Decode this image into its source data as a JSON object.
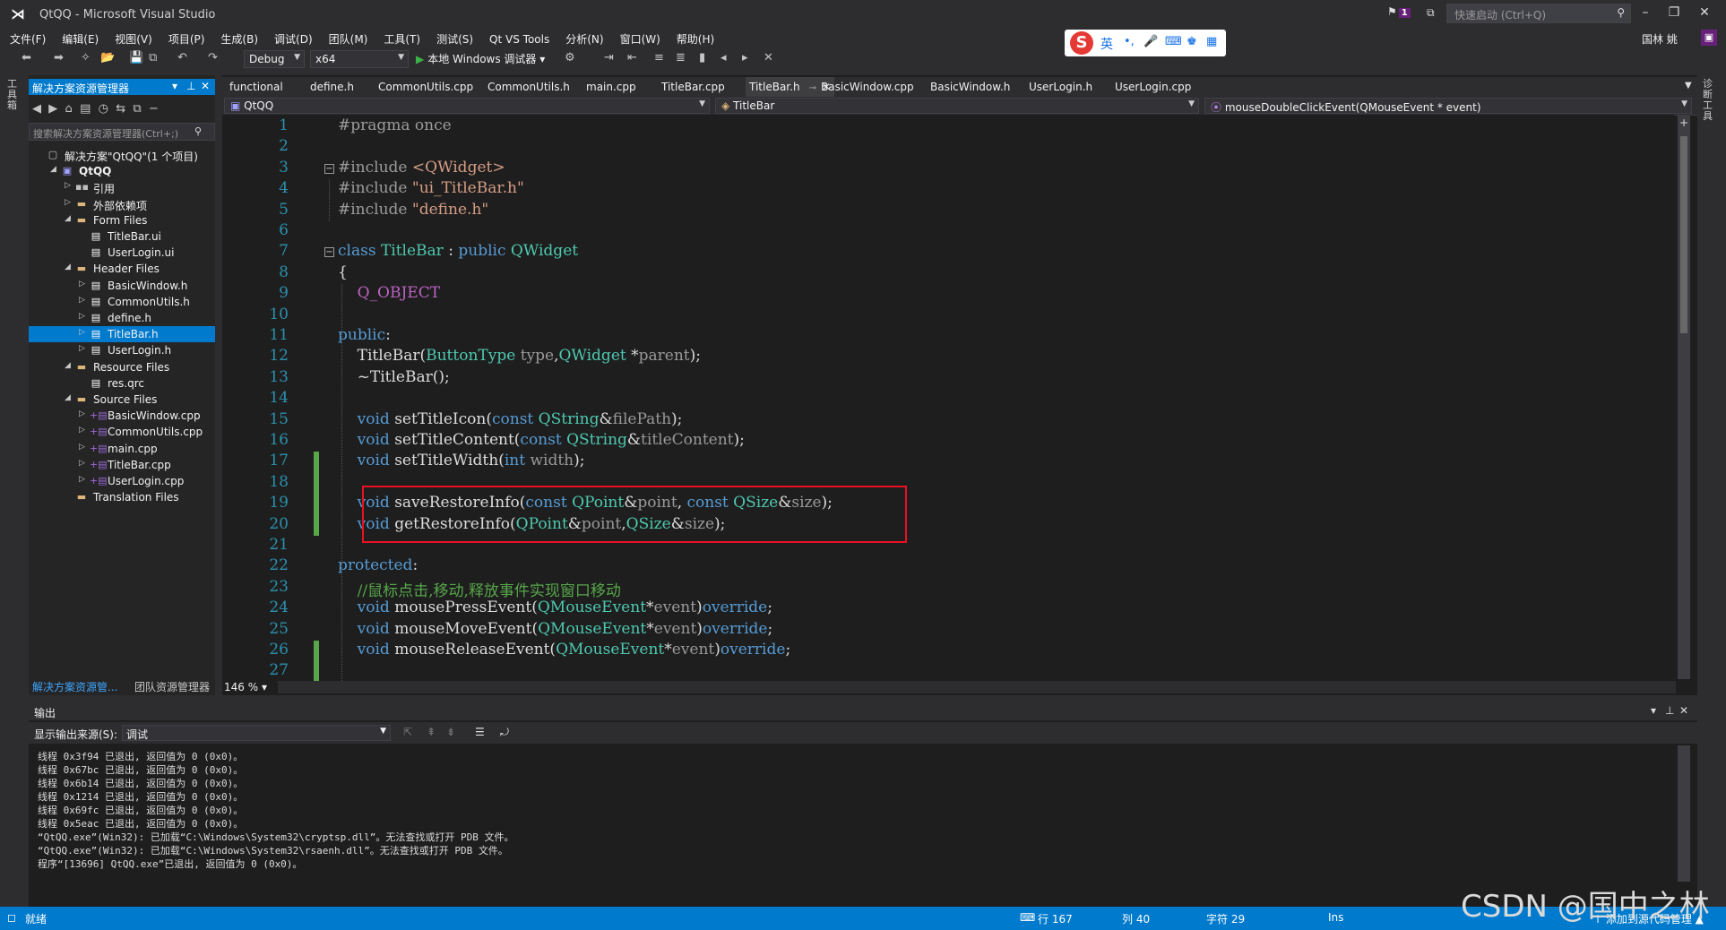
{
  "window": {
    "title": "QtQQ - Microsoft Visual Studio",
    "quick_launch_placeholder": "快速启动 (Ctrl+Q)",
    "notification_count": "1",
    "user_name": "国林 姚"
  },
  "menu": [
    "文件(F)",
    "编辑(E)",
    "视图(V)",
    "项目(P)",
    "生成(B)",
    "调试(D)",
    "团队(M)",
    "工具(T)",
    "测试(S)",
    "Qt VS Tools",
    "分析(N)",
    "窗口(W)",
    "帮助(H)"
  ],
  "ime": {
    "label": "英"
  },
  "toolbar": {
    "config": "Debug",
    "platform": "x64",
    "run_label": "本地 Windows 调试器"
  },
  "left_strip": {
    "label": "工具箱"
  },
  "right_strip": {
    "label": "诊断工具"
  },
  "solution_explorer": {
    "title": "解决方案资源管理器",
    "search_placeholder": "搜索解决方案资源管理器(Ctrl+;)",
    "items": [
      {
        "label": "解决方案\"QtQQ\"(1 个项目)",
        "type": "sol",
        "level": 0,
        "twisty": ""
      },
      {
        "label": "QtQQ",
        "type": "proj",
        "level": 1,
        "twisty": "◢"
      },
      {
        "label": "引用",
        "type": "ref",
        "level": 2,
        "twisty": "▷"
      },
      {
        "label": "外部依赖项",
        "type": "folder",
        "level": 2,
        "twisty": "▷"
      },
      {
        "label": "Form Files",
        "type": "folder",
        "level": 2,
        "twisty": "◢"
      },
      {
        "label": "TitleBar.ui",
        "type": "file",
        "level": 3,
        "twisty": ""
      },
      {
        "label": "UserLogin.ui",
        "type": "file",
        "level": 3,
        "twisty": ""
      },
      {
        "label": "Header Files",
        "type": "folder",
        "level": 2,
        "twisty": "◢"
      },
      {
        "label": "BasicWindow.h",
        "type": "file",
        "level": 3,
        "twisty": "▷"
      },
      {
        "label": "CommonUtils.h",
        "type": "file",
        "level": 3,
        "twisty": "▷"
      },
      {
        "label": "define.h",
        "type": "file",
        "level": 3,
        "twisty": "▷"
      },
      {
        "label": "TitleBar.h",
        "type": "file",
        "level": 3,
        "twisty": "▷",
        "selected": true
      },
      {
        "label": "UserLogin.h",
        "type": "file",
        "level": 3,
        "twisty": "▷"
      },
      {
        "label": "Resource Files",
        "type": "folder",
        "level": 2,
        "twisty": "◢"
      },
      {
        "label": "res.qrc",
        "type": "file",
        "level": 3,
        "twisty": ""
      },
      {
        "label": "Source Files",
        "type": "folder",
        "level": 2,
        "twisty": "◢"
      },
      {
        "label": "BasicWindow.cpp",
        "type": "cpp",
        "level": 3,
        "twisty": "▷"
      },
      {
        "label": "CommonUtils.cpp",
        "type": "cpp",
        "level": 3,
        "twisty": "▷"
      },
      {
        "label": "main.cpp",
        "type": "cpp",
        "level": 3,
        "twisty": "▷"
      },
      {
        "label": "TitleBar.cpp",
        "type": "cpp",
        "level": 3,
        "twisty": "▷"
      },
      {
        "label": "UserLogin.cpp",
        "type": "cpp",
        "level": 3,
        "twisty": "▷"
      },
      {
        "label": "Translation Files",
        "type": "folder",
        "level": 2,
        "twisty": ""
      }
    ],
    "bottom_tabs": [
      "解决方案资源管...",
      "团队资源管理器"
    ]
  },
  "editor": {
    "tabs": [
      {
        "label": "functional"
      },
      {
        "label": "define.h"
      },
      {
        "label": "CommonUtils.cpp"
      },
      {
        "label": "CommonUtils.h"
      },
      {
        "label": "main.cpp"
      },
      {
        "label": "TitleBar.cpp"
      },
      {
        "label": "TitleBar.h",
        "active": true
      },
      {
        "label": "BasicWindow.cpp"
      },
      {
        "label": "BasicWindow.h"
      },
      {
        "label": "UserLogin.h"
      },
      {
        "label": "UserLogin.cpp"
      }
    ],
    "nav_project": "QtQQ",
    "nav_class": "TitleBar",
    "nav_member": "mouseDoubleClickEvent(QMouseEvent * event)",
    "zoom": "146 %",
    "lines": [
      [
        [
          "pp",
          "#pragma once"
        ]
      ],
      [],
      [
        [
          "pp",
          "#include "
        ],
        [
          "st",
          "<QWidget>"
        ]
      ],
      [
        [
          "pp",
          "#include "
        ],
        [
          "st",
          "\"ui_TitleBar.h\""
        ]
      ],
      [
        [
          "pp",
          "#include "
        ],
        [
          "st",
          "\"define.h\""
        ]
      ],
      [],
      [
        [
          "kw",
          "class "
        ],
        [
          "ty",
          "TitleBar"
        ],
        [
          "tx",
          " : "
        ],
        [
          "kw",
          "public "
        ],
        [
          "ty",
          "QWidget"
        ]
      ],
      [
        [
          "tx",
          "{"
        ]
      ],
      [
        [
          "tx",
          "    "
        ],
        [
          "mc",
          "Q_OBJECT"
        ]
      ],
      [],
      [
        [
          "kw",
          "public"
        ],
        [
          "tx",
          ":"
        ]
      ],
      [
        [
          "tx",
          "    TitleBar("
        ],
        [
          "ty",
          "ButtonType"
        ],
        [
          "pm",
          " type"
        ],
        [
          "tx",
          ","
        ],
        [
          "ty",
          "QWidget"
        ],
        [
          "tx",
          " *"
        ],
        [
          "pm",
          "parent"
        ],
        [
          "tx",
          ");"
        ]
      ],
      [
        [
          "tx",
          "    ~TitleBar();"
        ]
      ],
      [],
      [
        [
          "tx",
          "    "
        ],
        [
          "kw",
          "void"
        ],
        [
          "tx",
          " setTitleIcon("
        ],
        [
          "kw",
          "const"
        ],
        [
          "tx",
          " "
        ],
        [
          "ty",
          "QString"
        ],
        [
          "tx",
          "&"
        ],
        [
          "pm",
          "filePath"
        ],
        [
          "tx",
          ");"
        ]
      ],
      [
        [
          "tx",
          "    "
        ],
        [
          "kw",
          "void"
        ],
        [
          "tx",
          " setTitleContent("
        ],
        [
          "kw",
          "const"
        ],
        [
          "tx",
          " "
        ],
        [
          "ty",
          "QString"
        ],
        [
          "tx",
          "&"
        ],
        [
          "pm",
          "titleContent"
        ],
        [
          "tx",
          ");"
        ]
      ],
      [
        [
          "tx",
          "    "
        ],
        [
          "kw",
          "void"
        ],
        [
          "tx",
          " setTitleWidth("
        ],
        [
          "kw",
          "int"
        ],
        [
          "pm",
          " width"
        ],
        [
          "tx",
          ");"
        ]
      ],
      [],
      [
        [
          "tx",
          "    "
        ],
        [
          "kw",
          "void"
        ],
        [
          "tx",
          " saveRestoreInfo("
        ],
        [
          "kw",
          "const"
        ],
        [
          "tx",
          " "
        ],
        [
          "ty",
          "QPoint"
        ],
        [
          "tx",
          "&"
        ],
        [
          "pm",
          "point"
        ],
        [
          "tx",
          ", "
        ],
        [
          "kw",
          "const"
        ],
        [
          "tx",
          " "
        ],
        [
          "ty",
          "QSize"
        ],
        [
          "tx",
          "&"
        ],
        [
          "pm",
          "size"
        ],
        [
          "tx",
          ");"
        ]
      ],
      [
        [
          "tx",
          "    "
        ],
        [
          "kw",
          "void"
        ],
        [
          "tx",
          " getRestoreInfo("
        ],
        [
          "ty",
          "QPoint"
        ],
        [
          "tx",
          "&"
        ],
        [
          "pm",
          "point"
        ],
        [
          "tx",
          ","
        ],
        [
          "ty",
          "QSize"
        ],
        [
          "tx",
          "&"
        ],
        [
          "pm",
          "size"
        ],
        [
          "tx",
          ");"
        ]
      ],
      [],
      [
        [
          "kw",
          "protected"
        ],
        [
          "tx",
          ":"
        ]
      ],
      [
        [
          "tx",
          "    "
        ],
        [
          "cm",
          "//鼠标点击,移动,释放事件实现窗口移动"
        ]
      ],
      [
        [
          "tx",
          "    "
        ],
        [
          "kw",
          "void"
        ],
        [
          "tx",
          " mousePressEvent("
        ],
        [
          "ty",
          "QMouseEvent"
        ],
        [
          "tx",
          "*"
        ],
        [
          "pm",
          "event"
        ],
        [
          "tx",
          ")"
        ],
        [
          "kw",
          "override"
        ],
        [
          "tx",
          ";"
        ]
      ],
      [
        [
          "tx",
          "    "
        ],
        [
          "kw",
          "void"
        ],
        [
          "tx",
          " mouseMoveEvent("
        ],
        [
          "ty",
          "QMouseEvent"
        ],
        [
          "tx",
          "*"
        ],
        [
          "pm",
          "event"
        ],
        [
          "tx",
          ")"
        ],
        [
          "kw",
          "override"
        ],
        [
          "tx",
          ";"
        ]
      ],
      [
        [
          "tx",
          "    "
        ],
        [
          "kw",
          "void"
        ],
        [
          "tx",
          " mouseReleaseEvent("
        ],
        [
          "ty",
          "QMouseEvent"
        ],
        [
          "tx",
          "*"
        ],
        [
          "pm",
          "event"
        ],
        [
          "tx",
          ")"
        ],
        [
          "kw",
          "override"
        ],
        [
          "tx",
          ";"
        ]
      ],
      []
    ]
  },
  "output": {
    "title": "输出",
    "source_label": "显示输出来源(S):",
    "source_value": "调试",
    "lines": [
      "线程 0x3f94 已退出, 返回值为 0 (0x0)。",
      "线程 0x67bc 已退出, 返回值为 0 (0x0)。",
      "线程 0x6b14 已退出, 返回值为 0 (0x0)。",
      "线程 0x1214 已退出, 返回值为 0 (0x0)。",
      "线程 0x69fc 已退出, 返回值为 0 (0x0)。",
      "线程 0x5eac 已退出, 返回值为 0 (0x0)。",
      "“QtQQ.exe”(Win32): 已加载“C:\\Windows\\System32\\cryptsp.dll”。无法查找或打开 PDB 文件。",
      "“QtQQ.exe”(Win32): 已加载“C:\\Windows\\System32\\rsaenh.dll”。无法查找或打开 PDB 文件。",
      "程序“[13696] QtQQ.exe”已退出, 返回值为 0 (0x0)。"
    ]
  },
  "status": {
    "ready": "就绪",
    "line": "行 167",
    "col": "列 40",
    "ch": "字符 29",
    "mode": "Ins",
    "source_control": "↑ 添加到源代码管理 ▲"
  },
  "watermark": "CSDN @国中之林",
  "colors": {
    "accent": "#007acc",
    "highlight_box": "#e81123",
    "editor_bg": "#1e1e1e"
  }
}
